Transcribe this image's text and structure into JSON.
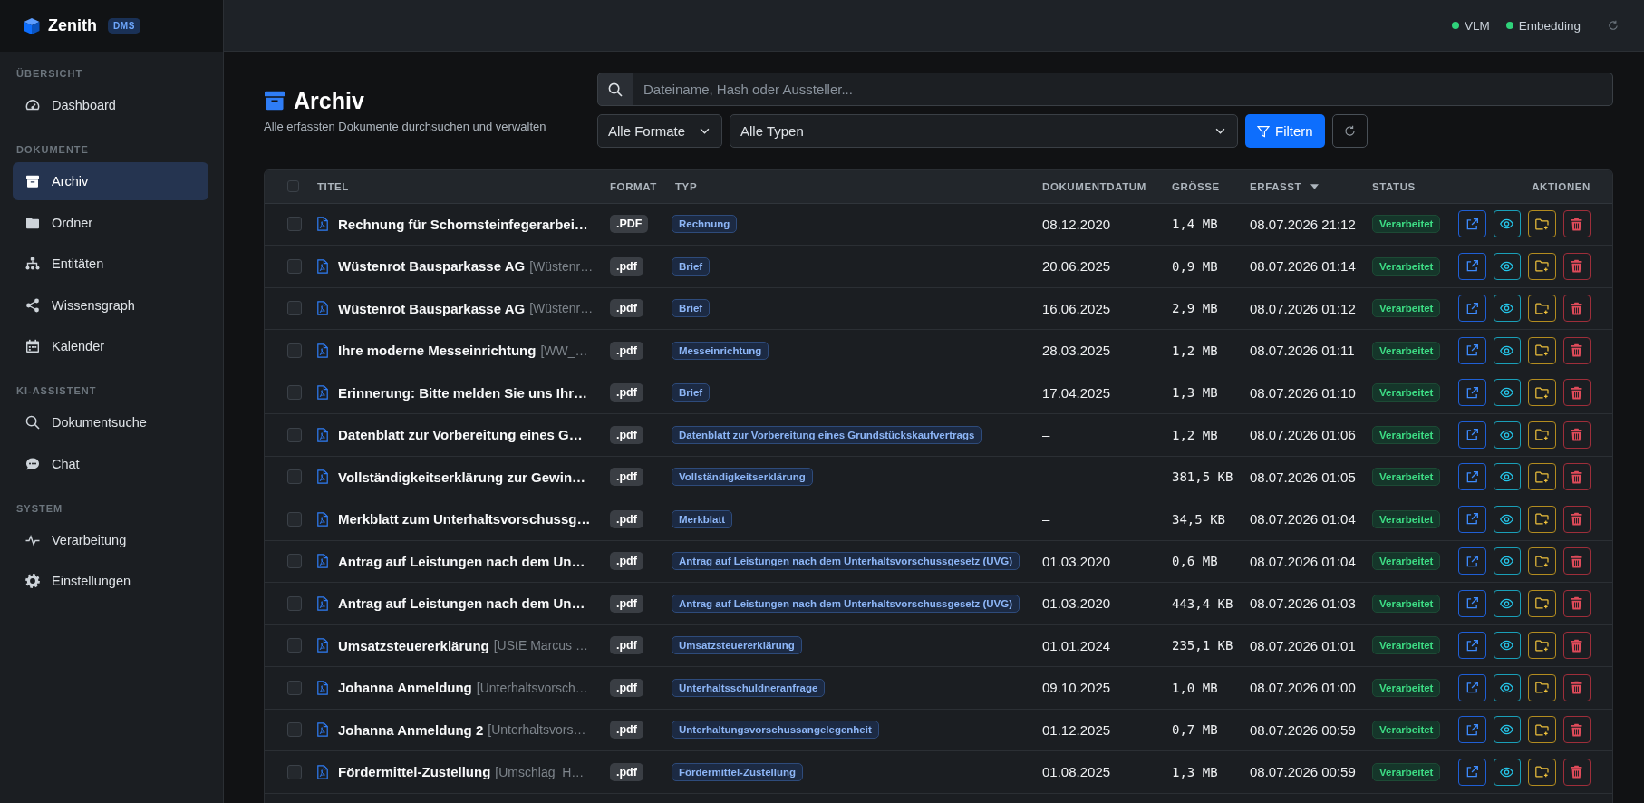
{
  "brand": {
    "name": "Zenith",
    "badge": "DMS"
  },
  "sidebar": {
    "sections": [
      {
        "heading": "ÜBERSICHT",
        "items": [
          {
            "label": "Dashboard",
            "selected": false
          }
        ]
      },
      {
        "heading": "DOKUMENTE",
        "items": [
          {
            "label": "Archiv",
            "selected": true
          },
          {
            "label": "Ordner",
            "selected": false
          },
          {
            "label": "Entitäten",
            "selected": false
          },
          {
            "label": "Wissensgraph",
            "selected": false
          },
          {
            "label": "Kalender",
            "selected": false
          }
        ]
      },
      {
        "heading": "KI-ASSISTENT",
        "items": [
          {
            "label": "Dokumentsuche",
            "selected": false
          },
          {
            "label": "Chat",
            "selected": false
          }
        ]
      },
      {
        "heading": "SYSTEM",
        "items": [
          {
            "label": "Verarbeitung",
            "selected": false
          },
          {
            "label": "Einstellungen",
            "selected": false
          }
        ]
      }
    ]
  },
  "topbar": {
    "services": [
      {
        "label": "VLM",
        "online": true
      },
      {
        "label": "Embedding",
        "online": true
      }
    ]
  },
  "page_header": {
    "title": "Archiv",
    "subtitle": "Alle erfassten Dokumente durchsuchen und verwalten"
  },
  "search": {
    "placeholder": "Dateiname, Hash oder Aussteller..."
  },
  "filters": {
    "format_select": "Alle Formate",
    "type_select": "Alle Typen",
    "filter_button": "Filtern"
  },
  "table": {
    "select_all": {
      "checked": false
    },
    "columns": [
      {
        "label": "TITEL",
        "sorted": false
      },
      {
        "label": "FORMAT",
        "sorted": false
      },
      {
        "label": "TYP",
        "sorted": false
      },
      {
        "label": "DOKUMENTDATUM",
        "sorted": false
      },
      {
        "label": "GRÖSSE",
        "sorted": false
      },
      {
        "label": "ERFASST",
        "sorted": true
      },
      {
        "label": "STATUS",
        "sorted": false
      },
      {
        "label": "AKTIONEN",
        "sorted": false
      }
    ],
    "rows": [
      {
        "checked": false,
        "title": "Rechnung für Schornsteinfegerarbei…",
        "format": ".PDF",
        "type": "Rechnung",
        "date": "08.12.2020",
        "size": "1,4 MB",
        "captured": "08.07.2026 21:12",
        "status": {
          "label": "Verarbeitet",
          "complete": true
        }
      },
      {
        "checked": false,
        "title": "Wüstenrot Bausparkasse AG",
        "source": "[Wüstenr…",
        "format": ".pdf",
        "type": "Brief",
        "date": "20.06.2025",
        "size": "0,9 MB",
        "captured": "08.07.2026 01:14",
        "status": {
          "label": "Verarbeitet",
          "complete": true
        }
      },
      {
        "checked": false,
        "title": "Wüstenrot Bausparkasse AG",
        "source": "[Wüstenr…",
        "format": ".pdf",
        "type": "Brief",
        "date": "16.06.2025",
        "size": "2,9 MB",
        "captured": "08.07.2026 01:12",
        "status": {
          "label": "Verarbeitet",
          "complete": true
        }
      },
      {
        "checked": false,
        "title": "Ihre moderne Messeinrichtung",
        "source": "[WW_…",
        "format": ".pdf",
        "type": "Messeinrichtung",
        "date": "28.03.2025",
        "size": "1,2 MB",
        "captured": "08.07.2026 01:11",
        "status": {
          "label": "Verarbeitet",
          "complete": true
        }
      },
      {
        "checked": false,
        "title": "Erinnerung: Bitte melden Sie uns Ihr…",
        "format": ".pdf",
        "type": "Brief",
        "date": "17.04.2025",
        "size": "1,3 MB",
        "captured": "08.07.2026 01:10",
        "status": {
          "label": "Verarbeitet",
          "complete": true
        }
      },
      {
        "checked": false,
        "title": "Datenblatt zur Vorbereitung eines G…",
        "format": ".pdf",
        "type": "Datenblatt zur Vorbereitung eines Grundstückskaufvertrags",
        "date": "–",
        "size": "1,2 MB",
        "captured": "08.07.2026 01:06",
        "status": {
          "label": "Verarbeitet",
          "complete": true
        }
      },
      {
        "checked": false,
        "title": "Vollständigkeitserklärung zur Gewin…",
        "format": ".pdf",
        "type": "Vollständigkeitserklärung",
        "date": "–",
        "size": "381,5 KB",
        "captured": "08.07.2026 01:05",
        "status": {
          "label": "Verarbeitet",
          "complete": true
        }
      },
      {
        "checked": false,
        "title": "Merkblatt zum Unterhaltsvorschussg…",
        "format": ".pdf",
        "type": "Merkblatt",
        "date": "–",
        "size": "34,5 KB",
        "captured": "08.07.2026 01:04",
        "status": {
          "label": "Verarbeitet",
          "complete": true
        }
      },
      {
        "checked": false,
        "title": "Antrag auf Leistungen nach dem Un…",
        "format": ".pdf",
        "type": "Antrag auf Leistungen nach dem Unterhaltsvorschussgesetz (UVG)",
        "date": "01.03.2020",
        "size": "0,6 MB",
        "captured": "08.07.2026 01:04",
        "status": {
          "label": "Verarbeitet",
          "complete": true
        }
      },
      {
        "checked": false,
        "title": "Antrag auf Leistungen nach dem Un…",
        "format": ".pdf",
        "type": "Antrag auf Leistungen nach dem Unterhaltsvorschussgesetz (UVG)",
        "date": "01.03.2020",
        "size": "443,4 KB",
        "captured": "08.07.2026 01:03",
        "status": {
          "label": "Verarbeitet",
          "complete": true
        }
      },
      {
        "checked": false,
        "title": "Umsatzsteuererklärung",
        "source": "[UStE Marcus …",
        "format": ".pdf",
        "type": "Umsatzsteuererklärung",
        "date": "01.01.2024",
        "size": "235,1 KB",
        "captured": "08.07.2026 01:01",
        "status": {
          "label": "Verarbeitet",
          "complete": true
        }
      },
      {
        "checked": false,
        "title": "Johanna Anmeldung",
        "source": "[Unterhaltsvorsch…",
        "format": ".pdf",
        "type": "Unterhaltsschuldneranfrage",
        "date": "09.10.2025",
        "size": "1,0 MB",
        "captured": "08.07.2026 01:00",
        "status": {
          "label": "Verarbeitet",
          "complete": true
        }
      },
      {
        "checked": false,
        "title": "Johanna Anmeldung 2",
        "source": "[Unterhaltsvors…",
        "format": ".pdf",
        "type": "Unterhaltungsvorschussangelegenheit",
        "date": "01.12.2025",
        "size": "0,7 MB",
        "captured": "08.07.2026 00:59",
        "status": {
          "label": "Verarbeitet",
          "complete": true
        }
      },
      {
        "checked": false,
        "title": "Fördermittel-Zustellung",
        "source": "[Umschlag_H…",
        "format": ".pdf",
        "type": "Fördermittel-Zustellung",
        "date": "01.08.2025",
        "size": "1,3 MB",
        "captured": "08.07.2026 00:59",
        "status": {
          "label": "Verarbeitet",
          "complete": true
        }
      }
    ]
  }
}
